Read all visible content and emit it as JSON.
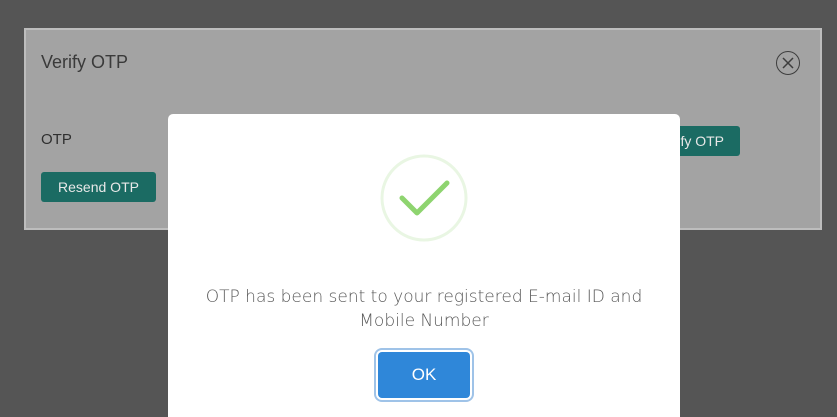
{
  "background_modal": {
    "title": "Verify OTP",
    "otp_label": "OTP",
    "resend_label": "Resend OTP",
    "verify_label_visible": "fy OTP",
    "close_icon": "close-circle-icon",
    "button_color": "#1b6b63"
  },
  "alert": {
    "icon": "success-check-icon",
    "icon_color": "#8ed46f",
    "message": "OTP has been sent to your registered E-mail ID and Mobile Number",
    "ok_label": "OK",
    "ok_color": "#2f87d9"
  }
}
